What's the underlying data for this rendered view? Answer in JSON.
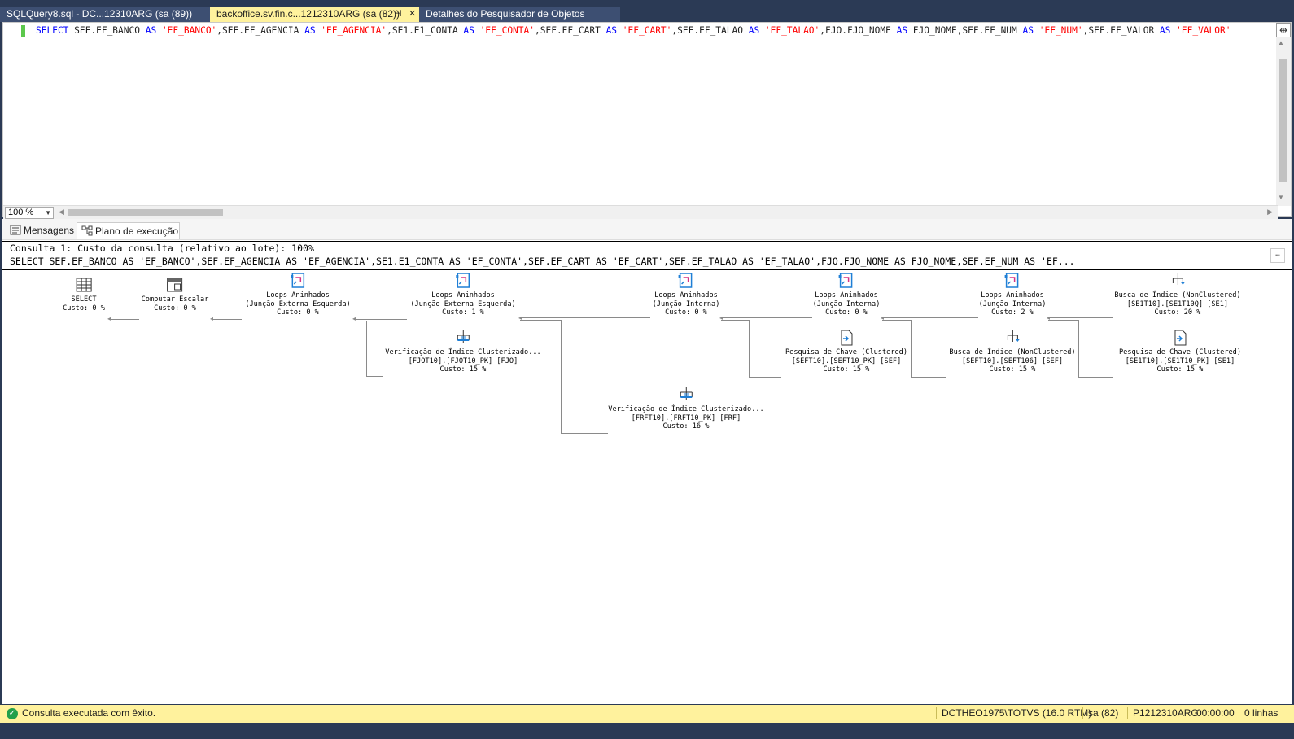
{
  "tabs": [
    {
      "label": "SQLQuery8.sql - DC...12310ARG (sa (89))",
      "active": false
    },
    {
      "label": "backoffice.sv.fin.c...1212310ARG (sa (82))",
      "active": true,
      "pin_icon": "pin-icon",
      "close_icon": "close-icon"
    },
    {
      "label": "Detalhes do Pesquisador de Objetos",
      "active": false
    }
  ],
  "editor": {
    "sql_tokens": [
      {
        "t": "kw",
        "v": "SELECT "
      },
      {
        "t": "txt",
        "v": "SEF.EF_BANCO "
      },
      {
        "t": "kw",
        "v": "AS "
      },
      {
        "t": "str",
        "v": "'EF_BANCO'"
      },
      {
        "t": "txt",
        "v": ",SEF.EF_AGENCIA "
      },
      {
        "t": "kw",
        "v": "AS "
      },
      {
        "t": "str",
        "v": "'EF_AGENCIA'"
      },
      {
        "t": "txt",
        "v": ",SE1.E1_CONTA "
      },
      {
        "t": "kw",
        "v": "AS "
      },
      {
        "t": "str",
        "v": "'EF_CONTA'"
      },
      {
        "t": "txt",
        "v": ",SEF.EF_CART "
      },
      {
        "t": "kw",
        "v": "AS "
      },
      {
        "t": "str",
        "v": "'EF_CART'"
      },
      {
        "t": "txt",
        "v": ",SEF.EF_TALAO "
      },
      {
        "t": "kw",
        "v": "AS "
      },
      {
        "t": "str",
        "v": "'EF_TALAO'"
      },
      {
        "t": "txt",
        "v": ",FJO.FJO_NOME "
      },
      {
        "t": "kw",
        "v": "AS "
      },
      {
        "t": "txt",
        "v": "FJO_NOME"
      },
      {
        "t": "txt",
        "v": ",SEF.EF_NUM "
      },
      {
        "t": "kw",
        "v": "AS "
      },
      {
        "t": "str",
        "v": "'EF_NUM'"
      },
      {
        "t": "txt",
        "v": ",SEF.EF_VALOR "
      },
      {
        "t": "kw",
        "v": "AS "
      },
      {
        "t": "str",
        "v": "'EF_VALOR'"
      }
    ],
    "zoom": "100 %"
  },
  "results": {
    "tabs": [
      {
        "label": "Mensagens",
        "icon": "messages-icon"
      },
      {
        "label": "Plano de execução",
        "icon": "execution-plan-icon"
      }
    ],
    "query_header": "Consulta 1: Custo da consulta (relativo ao lote): 100%",
    "query_text": "SELECT SEF.EF_BANCO AS 'EF_BANCO',SEF.EF_AGENCIA AS 'EF_AGENCIA',SE1.E1_CONTA AS 'EF_CONTA',SEF.EF_CART AS 'EF_CART',SEF.EF_TALAO AS 'EF_TALAO',FJO.FJO_NOME AS FJO_NOME,SEF.EF_NUM AS 'EF..."
  },
  "plan": {
    "select": {
      "l1": "SELECT",
      "l2": "",
      "l3": "Custo: 0 %",
      "icon": "select-icon"
    },
    "compute": {
      "l1": "Computar Escalar",
      "l2": "",
      "l3": "Custo: 0 %",
      "icon": "compute-scalar-icon"
    },
    "loop1": {
      "l1": "Loops Aninhados",
      "l2": "(Junção Externa Esquerda)",
      "l3": "Custo: 0 %",
      "icon": "nested-loops-icon"
    },
    "loop2": {
      "l1": "Loops Aninhados",
      "l2": "(Junção Externa Esquerda)",
      "l3": "Custo: 1 %",
      "icon": "nested-loops-icon"
    },
    "scan_fjo": {
      "l1": "Verificação de Índice Clusterizado...",
      "l2": "[FJOT10].[FJOT10_PK] [FJO]",
      "l3": "Custo: 15 %",
      "icon": "clustered-index-scan-icon"
    },
    "loop3": {
      "l1": "Loops Aninhados",
      "l2": "(Junção Interna)",
      "l3": "Custo: 0 %",
      "icon": "nested-loops-icon"
    },
    "scan_frf": {
      "l1": "Verificação de Índice Clusterizado...",
      "l2": "[FRFT10].[FRFT10_PK] [FRF]",
      "l3": "Custo: 16 %",
      "icon": "clustered-index-scan-icon"
    },
    "loop4": {
      "l1": "Loops Aninhados",
      "l2": "(Junção Interna)",
      "l3": "Custo: 0 %",
      "icon": "nested-loops-icon"
    },
    "lookup_sef": {
      "l1": "Pesquisa de Chave (Clustered)",
      "l2": "[SEFT10].[SEFT10_PK] [SEF]",
      "l3": "Custo: 15 %",
      "icon": "key-lookup-icon"
    },
    "loop5": {
      "l1": "Loops Aninhados",
      "l2": "(Junção Interna)",
      "l3": "Custo: 2 %",
      "icon": "nested-loops-icon"
    },
    "seek_sef": {
      "l1": "Busca de Índice (NonClustered)",
      "l2": "[SEFT10].[SEFT106] [SEF]",
      "l3": "Custo: 15 %",
      "icon": "index-seek-icon"
    },
    "seek_se1": {
      "l1": "Busca de Índice (NonClustered)",
      "l2": "[SE1T10].[SE1T10Q] [SE1]",
      "l3": "Custo: 20 %",
      "icon": "index-seek-icon"
    },
    "lookup_se1": {
      "l1": "Pesquisa de Chave (Clustered)",
      "l2": "[SE1T10].[SE1T10_PK] [SE1]",
      "l3": "Custo: 15 %",
      "icon": "key-lookup-icon"
    }
  },
  "status": {
    "message": "Consulta executada com êxito.",
    "server": "DCTHEO1975\\TOTVS (16.0 RTM)",
    "user": "sa (82)",
    "database": "P1212310ARG",
    "elapsed": "00:00:00",
    "rows": "0 linhas"
  },
  "colors": {
    "accent_yellow": "#fff29d",
    "dark_chrome": "#2b3a55",
    "keyword": "#0000ff",
    "string": "#ff0000"
  }
}
